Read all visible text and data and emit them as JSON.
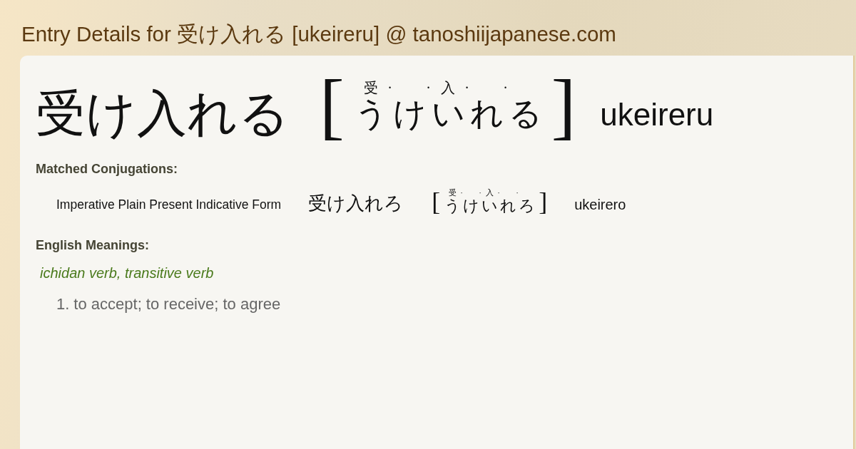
{
  "page_title": "Entry Details for 受け入れる [ukeireru] @ tanoshiijapanese.com",
  "entry": {
    "word": "受け入れる",
    "bracket_open": "[",
    "reading": [
      {
        "kana": "う",
        "kanji": "受"
      },
      {
        "kana": "け"
      },
      {
        "kana": "い",
        "kanji": "入"
      },
      {
        "kana": "れ"
      },
      {
        "kana": "る"
      }
    ],
    "boundary_mark": "·",
    "bracket_close": "]",
    "romaji": "ukeireru"
  },
  "matched_conjugations": {
    "heading": "Matched Conjugations:",
    "items": [
      {
        "form": "Imperative Plain Present Indicative Form",
        "word": "受け入れろ",
        "bracket_open": "[",
        "reading": [
          {
            "kana": "う",
            "kanji": "受"
          },
          {
            "kana": "け"
          },
          {
            "kana": "い",
            "kanji": "入"
          },
          {
            "kana": "れ"
          },
          {
            "kana": "ろ"
          }
        ],
        "boundary_mark": "·",
        "bracket_close": "]",
        "romaji": "ukeirero"
      }
    ]
  },
  "english_meanings": {
    "heading": "English Meanings:",
    "part_of_speech": "ichidan verb, transitive verb",
    "senses": [
      {
        "number": "1.",
        "gloss": "to accept; to receive; to agree"
      }
    ]
  }
}
